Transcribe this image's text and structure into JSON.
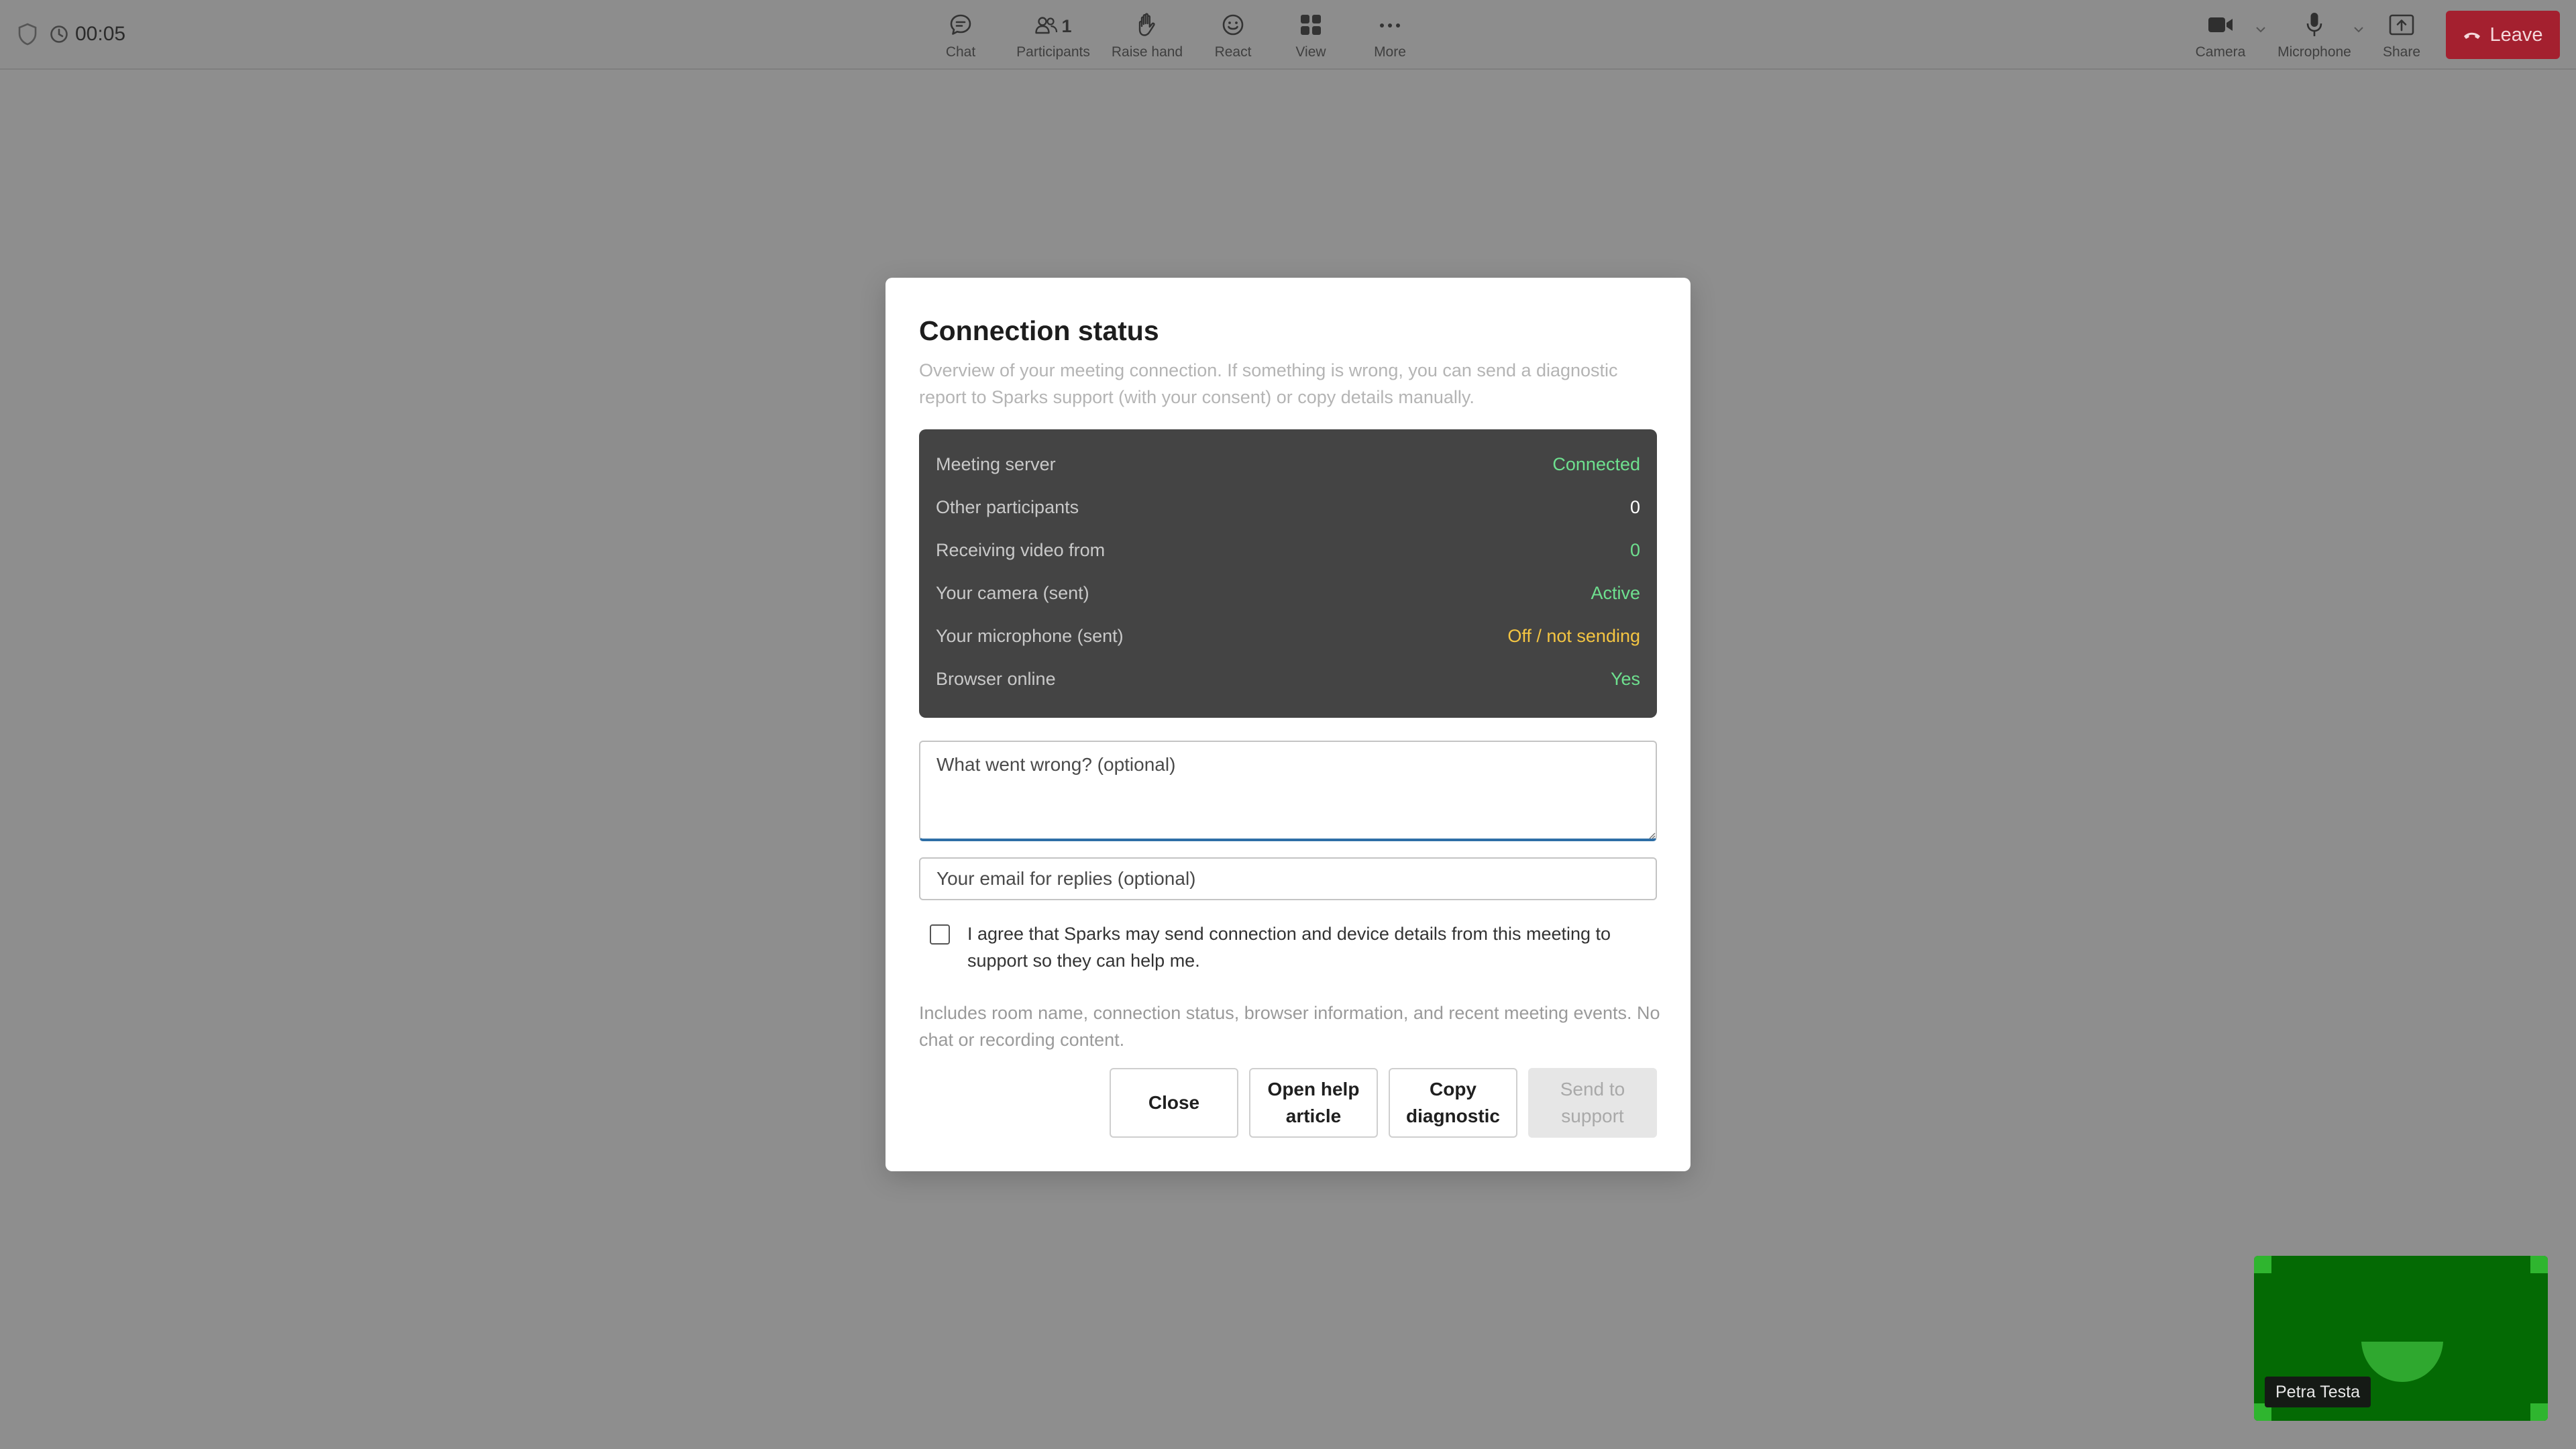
{
  "header": {
    "timer": "00:05",
    "toolbar": [
      {
        "id": "chat",
        "label": "Chat",
        "icon": "chat-icon"
      },
      {
        "id": "participants",
        "label": "Participants",
        "icon": "participants-icon",
        "count": "1"
      },
      {
        "id": "raise-hand",
        "label": "Raise hand",
        "icon": "hand-icon"
      },
      {
        "id": "react",
        "label": "React",
        "icon": "smiley-icon"
      },
      {
        "id": "view",
        "label": "View",
        "icon": "grid-icon"
      },
      {
        "id": "more",
        "label": "More",
        "icon": "more-icon"
      }
    ],
    "devices": [
      {
        "id": "camera",
        "label": "Camera",
        "icon": "camera-icon"
      },
      {
        "id": "microphone",
        "label": "Microphone",
        "icon": "microphone-icon"
      },
      {
        "id": "share",
        "label": "Share",
        "icon": "share-icon"
      }
    ],
    "leave_label": "Leave"
  },
  "modal": {
    "title": "Connection status",
    "description": "Overview of your meeting connection. If something is wrong, you can send a diagnostic report to Sparks support (with your consent) or copy details manually.",
    "status": [
      {
        "label": "Meeting server",
        "value": "Connected",
        "tone": "green"
      },
      {
        "label": "Other participants",
        "value": "0",
        "tone": "white"
      },
      {
        "label": "Receiving video from",
        "value": "0",
        "tone": "green"
      },
      {
        "label": "Your camera (sent)",
        "value": "Active",
        "tone": "green"
      },
      {
        "label": "Your microphone (sent)",
        "value": "Off / not sending",
        "tone": "yellow"
      },
      {
        "label": "Browser online",
        "value": "Yes",
        "tone": "green"
      }
    ],
    "problem_placeholder": "What went wrong? (optional)",
    "email_placeholder": "Your email for replies (optional)",
    "consent_text": "I agree that Sparks may send connection and device details from this meeting to support so they can help me.",
    "includes_text": "Includes room name, connection status, browser information, and recent meeting events. No chat or recording content.",
    "buttons": {
      "close": "Close",
      "help": "Open help article",
      "copy": "Copy diagnostic",
      "send": "Send to support"
    }
  },
  "self_view": {
    "name": "Petra Testa"
  },
  "colors": {
    "leave": "#a4202f",
    "status_panel": "#444444",
    "status_green": "#6ee08f",
    "status_yellow": "#f4c542",
    "self_view_bg": "#046a04"
  }
}
